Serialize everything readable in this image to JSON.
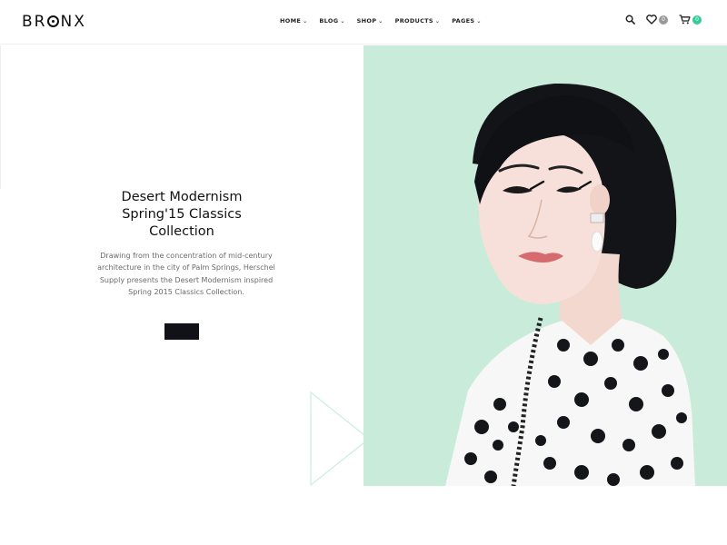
{
  "brand": {
    "logo_prefix": "BR",
    "logo_suffix": "NX"
  },
  "nav": {
    "items": [
      {
        "label": "HOME"
      },
      {
        "label": "BLOG"
      },
      {
        "label": "SHOP"
      },
      {
        "label": "PRODUCTS"
      },
      {
        "label": "PAGES"
      }
    ]
  },
  "header": {
    "wishlist_count": "0",
    "cart_count": "0",
    "search_icon": "search-icon",
    "wishlist_icon": "heart-icon",
    "cart_icon": "cart-icon"
  },
  "hero": {
    "title_line1": "Desert Modernism",
    "title_line2": "Spring'15 Classics",
    "title_line3": "Collection",
    "description": "Drawing from the concentration of mid-century architecture in the city of Palm Springs, Herschel Supply presents the Desert Modernism inspired Spring 2015 Classics Collection.",
    "button_label": "",
    "image_bg_color": "#c9ecd9"
  },
  "colors": {
    "accent_green": "#33cc99",
    "badge_grey": "#9a9a9a",
    "button_dark": "#111218"
  }
}
